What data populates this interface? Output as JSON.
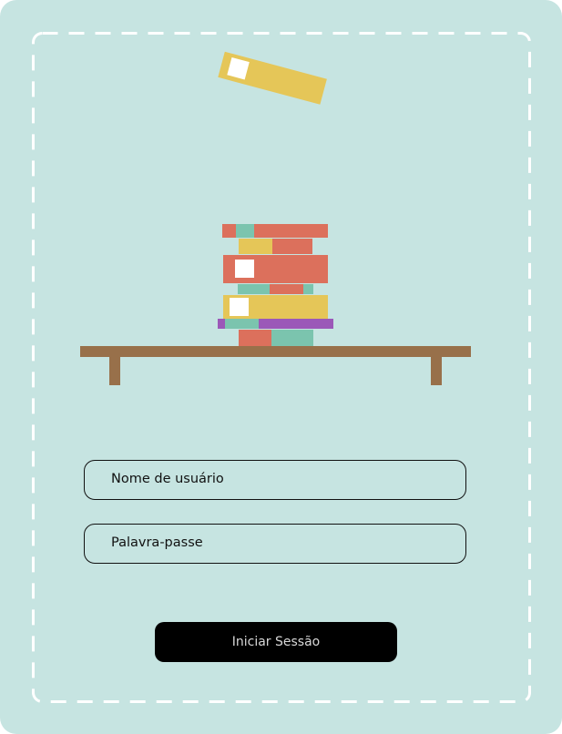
{
  "login": {
    "username_placeholder": "Nome de usuário",
    "password_placeholder": "Palavra-passe",
    "submit_label": "Iniciar Sessão"
  },
  "colors": {
    "background": "#c6e4e1",
    "coral": "#dc705c",
    "teal": "#7bc4ae",
    "yellow": "#e5c658",
    "purple": "#9b58b8",
    "shelf": "#98704a",
    "button": "#000000"
  }
}
